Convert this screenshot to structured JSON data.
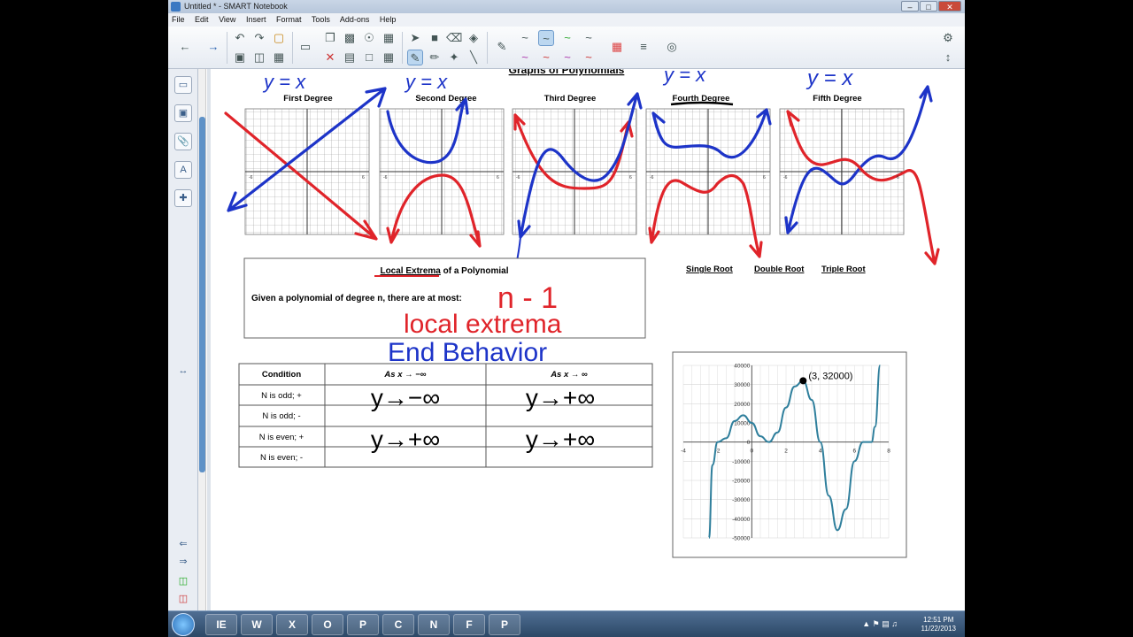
{
  "window": {
    "title": "Untitled * - SMART Notebook"
  },
  "menu": [
    "File",
    "Edit",
    "View",
    "Insert",
    "Format",
    "Tools",
    "Add-ons",
    "Help"
  ],
  "page": {
    "title": "Graphs of Polynomials",
    "degrees": [
      "First Degree",
      "Second Degree",
      "Third Degree",
      "Fourth Degree",
      "Fifth Degree"
    ],
    "handwritten_top": [
      "y = x",
      "y = x",
      "y = x",
      "y = x"
    ],
    "root_labels": [
      "Single Root",
      "Double Root",
      "Triple Root"
    ],
    "extrema_box": {
      "heading_underlined": "Local Extrema",
      "heading_rest": " of a Polynomial",
      "prompt": "Given a polynomial of degree n, there are at most:"
    },
    "handwritten": {
      "n_minus_1": "n - 1",
      "local_extrema": "local extrema",
      "end_behavior": "End Behavior"
    },
    "table": {
      "headers": [
        "Condition",
        "As x → −∞",
        "As x → ∞"
      ],
      "rows": [
        {
          "condition": "N is odd; +",
          "left": "y→−∞",
          "right": "y→+∞"
        },
        {
          "condition": "N is odd; -",
          "left": "",
          "right": ""
        },
        {
          "condition": "N is even; +",
          "left": "y→+∞",
          "right": "y→+∞"
        },
        {
          "condition": "N is even; -",
          "left": "",
          "right": ""
        }
      ]
    },
    "grid_tick_labels": [
      "-6",
      "-5",
      "-4",
      "-3",
      "-2",
      "-1",
      "1",
      "2",
      "3",
      "4",
      "5",
      "6"
    ]
  },
  "chart_data": {
    "type": "line",
    "x_ticks": [
      -4,
      -2,
      0,
      2,
      4,
      6,
      8
    ],
    "y_ticks": [
      40000,
      30000,
      20000,
      10000,
      0,
      -10000,
      -20000,
      -30000,
      -40000,
      -50000
    ],
    "xlim": [
      -4,
      8
    ],
    "ylim": [
      -50000,
      40000
    ],
    "grid": true,
    "annotation": {
      "label": "(3, 32000)",
      "x": 3,
      "y": 32000
    },
    "series": [
      {
        "x": [
          -2.5,
          -2.3,
          -2,
          -1.5,
          -1,
          -0.5,
          0,
          0.5,
          1,
          1.5,
          2,
          2.5,
          3,
          3.5,
          4,
          4.5,
          5,
          5.5,
          6,
          6.5,
          7,
          7.2,
          7.5
        ],
        "y": [
          -50000,
          -12000,
          0,
          2000,
          11000,
          14000,
          10000,
          3000,
          0,
          5000,
          18000,
          29000,
          32000,
          22000,
          0,
          -28000,
          -46000,
          -35000,
          -10000,
          0,
          0,
          8000,
          40000
        ]
      }
    ],
    "color": "#2f7f9c"
  },
  "taskbar": {
    "apps": [
      "IE",
      "W",
      "X",
      "O",
      "P",
      "C",
      "N",
      "F",
      "P"
    ],
    "clock_time": "12:51 PM",
    "clock_date": "11/22/2013"
  },
  "colors": {
    "ink_red": "#e0242a",
    "ink_blue": "#1d34c8",
    "toolbar_bg": "#eef1f6"
  }
}
